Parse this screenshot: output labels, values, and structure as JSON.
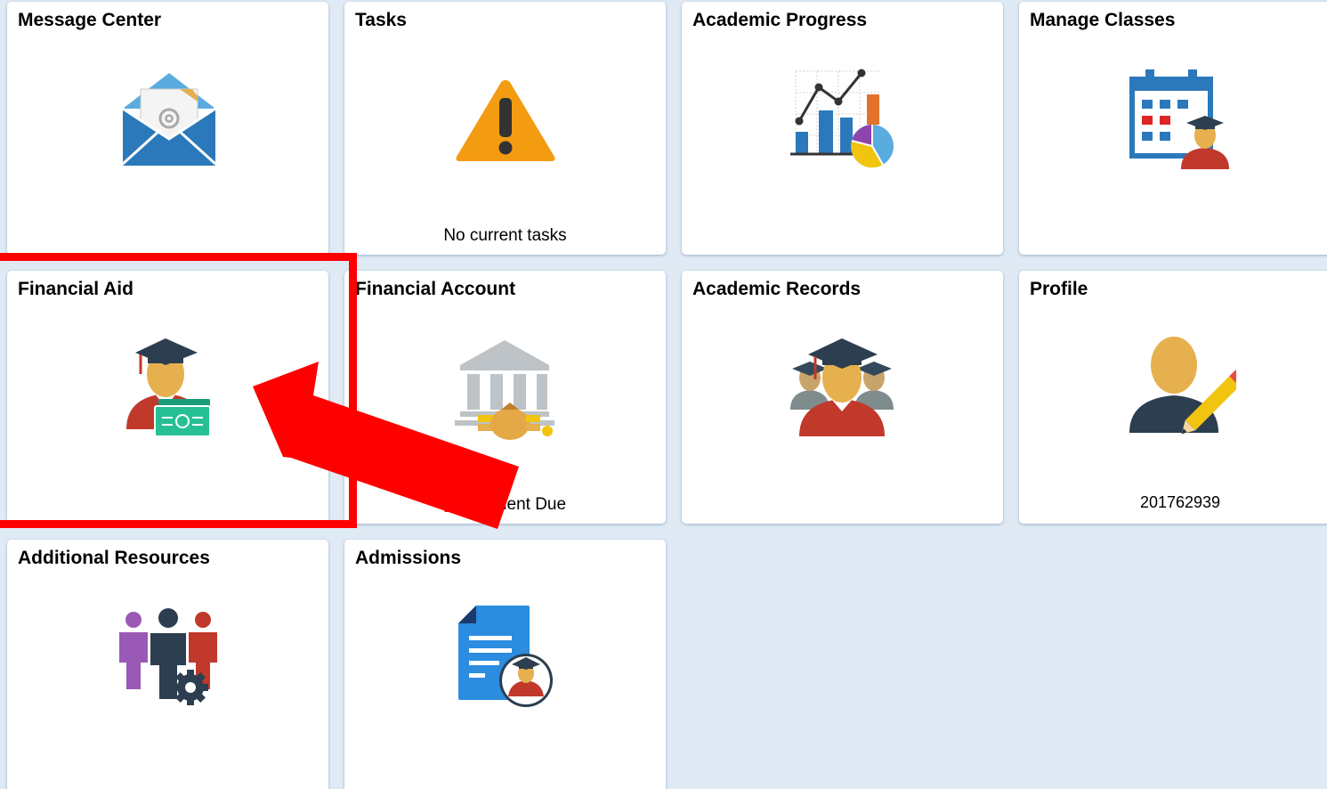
{
  "tiles": {
    "message_center": {
      "title": "Message Center",
      "icon": "envelope-icon"
    },
    "tasks": {
      "title": "Tasks",
      "icon": "warning-icon",
      "status": "No current tasks"
    },
    "academic_progress": {
      "title": "Academic Progress",
      "icon": "progress-chart-icon"
    },
    "manage_classes": {
      "title": "Manage Classes",
      "icon": "calendar-student-icon"
    },
    "financial_aid": {
      "title": "Financial Aid",
      "icon": "student-money-icon"
    },
    "financial_account": {
      "title": "Financial Account",
      "icon": "bank-icon",
      "status": "Payment Due"
    },
    "academic_records": {
      "title": "Academic Records",
      "icon": "graduates-icon"
    },
    "profile": {
      "title": "Profile",
      "icon": "profile-edit-icon",
      "id_number": "201762939"
    },
    "additional_resources": {
      "title": "Additional Resources",
      "icon": "people-gear-icon"
    },
    "admissions": {
      "title": "Admissions",
      "icon": "document-student-icon"
    }
  },
  "colors": {
    "background": "#dfeaf5",
    "tile": "#ffffff",
    "annotation": "#ff0000"
  }
}
